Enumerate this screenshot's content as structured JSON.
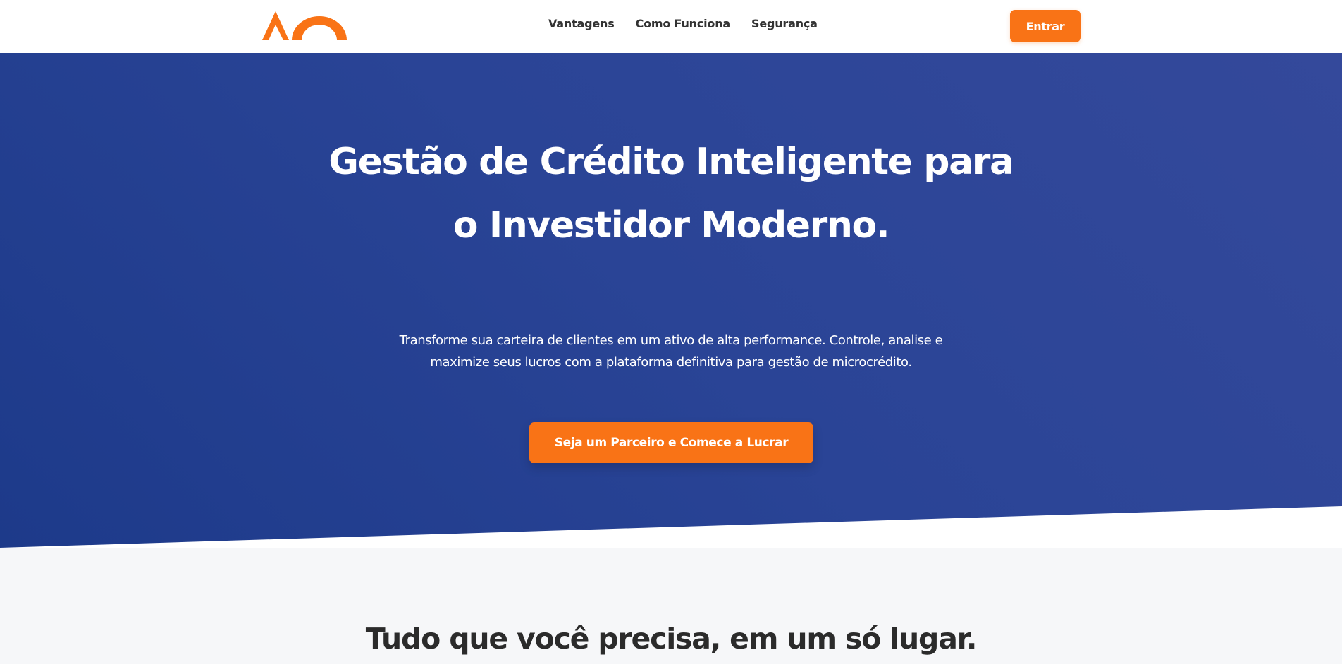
{
  "header": {
    "nav": [
      {
        "label": "Vantagens"
      },
      {
        "label": "Como Funciona"
      },
      {
        "label": "Segurança"
      }
    ],
    "login_label": "Entrar"
  },
  "hero": {
    "title": "Gestão de Crédito Inteligente para o Investidor Moderno.",
    "subtitle": "Transforme sua carteira de clientes em um ativo de alta performance. Controle, analise e maximize seus lucros com a plataforma definitiva para gestão de microcrédito.",
    "cta_label": "Seja um Parceiro e Comece a Lucrar"
  },
  "features": {
    "title": "Tudo que você precisa, em um só lugar."
  },
  "colors": {
    "accent": "#f97316",
    "hero_blue": "#2a4496",
    "text_dark": "#2b2b2b",
    "section_bg": "#f6f7f9"
  }
}
